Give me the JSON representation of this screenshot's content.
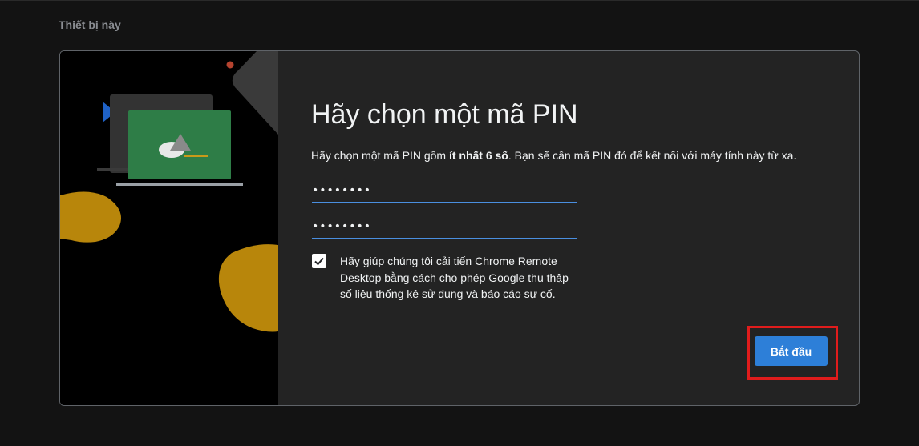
{
  "section": {
    "title": "Thiết bị này"
  },
  "dialog": {
    "heading": "Hãy chọn một mã PIN",
    "description_prefix": "Hãy chọn một mã PIN gồm ",
    "description_bold": "ít nhất 6 số",
    "description_suffix": ". Bạn sẽ cần mã PIN đó để kết nối với máy tính này từ xa.",
    "pin_value": "••••••••",
    "pin_confirm_value": "••••••••",
    "consent_checked": true,
    "consent_text": "Hãy giúp chúng tôi cải tiến Chrome Remote Desktop bằng cách cho phép Google thu thập số liệu thống kê sử dụng và báo cáo sự cố.",
    "start_label": "Bắt đầu"
  },
  "colors": {
    "accent": "#2d7fd8",
    "highlight": "#e01c1c",
    "illustration_green": "#2e7d47",
    "illustration_gold": "#b8860b"
  }
}
